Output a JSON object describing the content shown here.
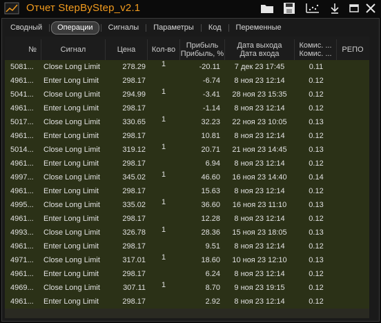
{
  "window": {
    "title": "Отчет StepByStep_v2.1",
    "accent": "#f39c1e",
    "icons": [
      "app-logo-icon",
      "folder-icon",
      "save-icon",
      "chart-icon",
      "download-icon",
      "minimize-icon",
      "close-icon"
    ]
  },
  "tabs": [
    {
      "label": "Сводный",
      "active": false
    },
    {
      "label": "Операции",
      "active": true
    },
    {
      "label": "Сигналы",
      "active": false
    },
    {
      "label": "Параметры",
      "active": false
    },
    {
      "label": "Код",
      "active": false
    },
    {
      "label": "Переменные",
      "active": false
    }
  ],
  "columns": {
    "num": "№",
    "signal": "Сигнал",
    "price": "Цена",
    "qty": "Кол-во",
    "profit_1": "Прибыль",
    "profit_2": "Прибыль, %",
    "date_1": "Дата выхода",
    "date_2": "Дата входа",
    "comm_1": "Комис. ...",
    "comm_2": "Комис. ...",
    "repo": "РЕПО"
  },
  "rows": [
    {
      "num": "5081...",
      "signal": "Close Long Limit",
      "price": "278.29",
      "qty": "1",
      "profit": "-20.11",
      "date": "7 дек 23 17:45",
      "comm": "0.11"
    },
    {
      "num": "4961...",
      "signal": "Enter Long Limit",
      "price": "298.17",
      "qty": "",
      "profit": "-6.74",
      "date": "8 ноя 23 12:14",
      "comm": "0.12"
    },
    {
      "num": "5041...",
      "signal": "Close Long Limit",
      "price": "294.99",
      "qty": "1",
      "profit": "-3.41",
      "date": "28 ноя 23 15:35",
      "comm": "0.12"
    },
    {
      "num": "4961...",
      "signal": "Enter Long Limit",
      "price": "298.17",
      "qty": "",
      "profit": "-1.14",
      "date": "8 ноя 23 12:14",
      "comm": "0.12"
    },
    {
      "num": "5017...",
      "signal": "Close Long Limit",
      "price": "330.65",
      "qty": "1",
      "profit": "32.23",
      "date": "22 ноя 23 10:05",
      "comm": "0.13"
    },
    {
      "num": "4961...",
      "signal": "Enter Long Limit",
      "price": "298.17",
      "qty": "",
      "profit": "10.81",
      "date": "8 ноя 23 12:14",
      "comm": "0.12"
    },
    {
      "num": "5014...",
      "signal": "Close Long Limit",
      "price": "319.12",
      "qty": "1",
      "profit": "20.71",
      "date": "21 ноя 23 14:45",
      "comm": "0.13"
    },
    {
      "num": "4961...",
      "signal": "Enter Long Limit",
      "price": "298.17",
      "qty": "",
      "profit": "6.94",
      "date": "8 ноя 23 12:14",
      "comm": "0.12"
    },
    {
      "num": "4997...",
      "signal": "Close Long Limit",
      "price": "345.02",
      "qty": "1",
      "profit": "46.60",
      "date": "16 ноя 23 14:40",
      "comm": "0.14"
    },
    {
      "num": "4961...",
      "signal": "Enter Long Limit",
      "price": "298.17",
      "qty": "",
      "profit": "15.63",
      "date": "8 ноя 23 12:14",
      "comm": "0.12"
    },
    {
      "num": "4995...",
      "signal": "Close Long Limit",
      "price": "335.02",
      "qty": "1",
      "profit": "36.60",
      "date": "16 ноя 23 11:10",
      "comm": "0.13"
    },
    {
      "num": "4961...",
      "signal": "Enter Long Limit",
      "price": "298.17",
      "qty": "",
      "profit": "12.28",
      "date": "8 ноя 23 12:14",
      "comm": "0.12"
    },
    {
      "num": "4993...",
      "signal": "Close Long Limit",
      "price": "326.78",
      "qty": "1",
      "profit": "28.36",
      "date": "15 ноя 23 18:05",
      "comm": "0.13"
    },
    {
      "num": "4961...",
      "signal": "Enter Long Limit",
      "price": "298.17",
      "qty": "",
      "profit": "9.51",
      "date": "8 ноя 23 12:14",
      "comm": "0.12"
    },
    {
      "num": "4971...",
      "signal": "Close Long Limit",
      "price": "317.01",
      "qty": "1",
      "profit": "18.60",
      "date": "10 ноя 23 12:10",
      "comm": "0.13"
    },
    {
      "num": "4961...",
      "signal": "Enter Long Limit",
      "price": "298.17",
      "qty": "",
      "profit": "6.24",
      "date": "8 ноя 23 12:14",
      "comm": "0.12"
    },
    {
      "num": "4969...",
      "signal": "Close Long Limit",
      "price": "307.11",
      "qty": "1",
      "profit": "8.70",
      "date": "9 ноя 23 19:15",
      "comm": "0.12"
    },
    {
      "num": "4961...",
      "signal": "Enter Long Limit",
      "price": "298.17",
      "qty": "",
      "profit": "2.92",
      "date": "8 ноя 23 12:14",
      "comm": "0.12"
    }
  ]
}
